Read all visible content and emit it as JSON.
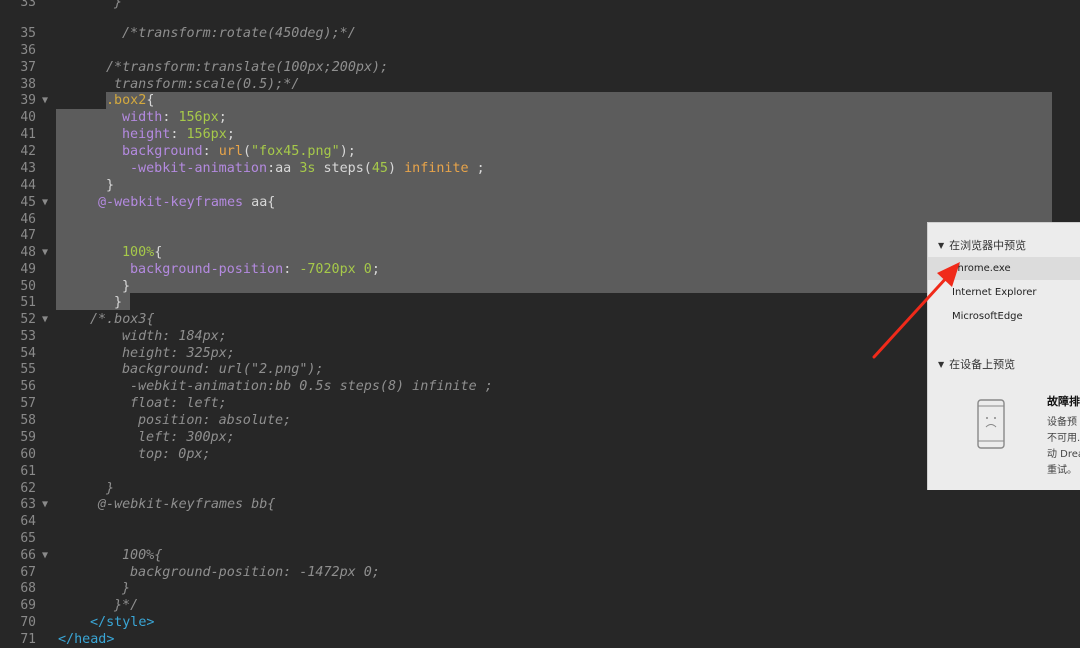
{
  "editor": {
    "lines": [
      {
        "n": "33",
        "fold": "",
        "indent": 114,
        "tokens": [
          [
            "t-com",
            "}"
          ]
        ]
      },
      {
        "n": "35",
        "fold": "",
        "indent": 122,
        "tokens": [
          [
            "t-com",
            "/*transform:rotate(450deg);*/"
          ]
        ]
      },
      {
        "n": "36",
        "fold": "",
        "indent": 122,
        "tokens": []
      },
      {
        "n": "37",
        "fold": "",
        "indent": 106,
        "tokens": [
          [
            "t-com",
            "/*transform:translate(100px;200px);"
          ]
        ]
      },
      {
        "n": "38",
        "fold": "",
        "indent": 114,
        "tokens": [
          [
            "t-com",
            "transform:scale(0.5);*/"
          ]
        ]
      },
      {
        "n": "39",
        "fold": "▼",
        "indent": 106,
        "tokens": [
          [
            "t-sel",
            ".box2"
          ],
          [
            "t-pun",
            "{"
          ]
        ]
      },
      {
        "n": "40",
        "fold": "",
        "indent": 122,
        "tokens": [
          [
            "t-prop",
            "width"
          ],
          [
            "t-pun",
            ": "
          ],
          [
            "t-val",
            "156px"
          ],
          [
            "t-pun",
            ";"
          ]
        ]
      },
      {
        "n": "41",
        "fold": "",
        "indent": 122,
        "tokens": [
          [
            "t-prop",
            "height"
          ],
          [
            "t-pun",
            ": "
          ],
          [
            "t-val",
            "156px"
          ],
          [
            "t-pun",
            ";"
          ]
        ]
      },
      {
        "n": "42",
        "fold": "",
        "indent": 122,
        "tokens": [
          [
            "t-prop",
            "background"
          ],
          [
            "t-pun",
            ": "
          ],
          [
            "t-fn",
            "url"
          ],
          [
            "t-pun",
            "("
          ],
          [
            "t-str",
            "\"fox45.png\""
          ],
          [
            "t-pun",
            ");"
          ]
        ]
      },
      {
        "n": "43",
        "fold": "",
        "indent": 130,
        "tokens": [
          [
            "t-prop",
            "-webkit-animation"
          ],
          [
            "t-pun",
            ":aa "
          ],
          [
            "t-val",
            "3s"
          ],
          [
            "t-pun",
            " steps("
          ],
          [
            "t-val",
            "45"
          ],
          [
            "t-pun",
            ") "
          ],
          [
            "t-fn",
            "infinite"
          ],
          [
            "t-pun",
            " ;"
          ]
        ]
      },
      {
        "n": "44",
        "fold": "",
        "indent": 106,
        "tokens": [
          [
            "t-pun",
            "}"
          ]
        ]
      },
      {
        "n": "45",
        "fold": "▼",
        "indent": 98,
        "tokens": [
          [
            "t-at",
            "@-webkit-keyframes"
          ],
          [
            "t-plain",
            " aa{"
          ]
        ]
      },
      {
        "n": "46",
        "fold": "",
        "indent": 122,
        "tokens": []
      },
      {
        "n": "47",
        "fold": "",
        "indent": 122,
        "tokens": []
      },
      {
        "n": "48",
        "fold": "▼",
        "indent": 122,
        "tokens": [
          [
            "t-val",
            "100%"
          ],
          [
            "t-pun",
            "{"
          ]
        ]
      },
      {
        "n": "49",
        "fold": "",
        "indent": 130,
        "tokens": [
          [
            "t-prop",
            "background-position"
          ],
          [
            "t-pun",
            ": "
          ],
          [
            "t-val",
            "-7020px 0"
          ],
          [
            "t-pun",
            ";"
          ]
        ]
      },
      {
        "n": "50",
        "fold": "",
        "indent": 122,
        "tokens": [
          [
            "t-pun",
            "}"
          ]
        ]
      },
      {
        "n": "51",
        "fold": "",
        "indent": 114,
        "tokens": [
          [
            "t-pun",
            "}"
          ]
        ]
      },
      {
        "n": "52",
        "fold": "▼",
        "indent": 90,
        "tokens": [
          [
            "t-com",
            "/*.box3{"
          ]
        ]
      },
      {
        "n": "53",
        "fold": "",
        "indent": 122,
        "tokens": [
          [
            "t-com",
            "width: 184px;"
          ]
        ]
      },
      {
        "n": "54",
        "fold": "",
        "indent": 122,
        "tokens": [
          [
            "t-com",
            "height: 325px;"
          ]
        ]
      },
      {
        "n": "55",
        "fold": "",
        "indent": 122,
        "tokens": [
          [
            "t-com",
            "background: url(\"2.png\");"
          ]
        ]
      },
      {
        "n": "56",
        "fold": "",
        "indent": 130,
        "tokens": [
          [
            "t-com",
            "-webkit-animation:bb 0.5s steps(8) infinite ;"
          ]
        ]
      },
      {
        "n": "57",
        "fold": "",
        "indent": 130,
        "tokens": [
          [
            "t-com",
            "float: left;"
          ]
        ]
      },
      {
        "n": "58",
        "fold": "",
        "indent": 138,
        "tokens": [
          [
            "t-com",
            "position: absolute;"
          ]
        ]
      },
      {
        "n": "59",
        "fold": "",
        "indent": 138,
        "tokens": [
          [
            "t-com",
            "left: 300px;"
          ]
        ]
      },
      {
        "n": "60",
        "fold": "",
        "indent": 138,
        "tokens": [
          [
            "t-com",
            "top: 0px;"
          ]
        ]
      },
      {
        "n": "61",
        "fold": "",
        "indent": 122,
        "tokens": []
      },
      {
        "n": "62",
        "fold": "",
        "indent": 106,
        "tokens": [
          [
            "t-com",
            "}"
          ]
        ]
      },
      {
        "n": "63",
        "fold": "▼",
        "indent": 98,
        "tokens": [
          [
            "t-com",
            "@-webkit-keyframes bb{"
          ]
        ]
      },
      {
        "n": "64",
        "fold": "",
        "indent": 122,
        "tokens": []
      },
      {
        "n": "65",
        "fold": "",
        "indent": 122,
        "tokens": []
      },
      {
        "n": "66",
        "fold": "▼",
        "indent": 122,
        "tokens": [
          [
            "t-com",
            "100%{"
          ]
        ]
      },
      {
        "n": "67",
        "fold": "",
        "indent": 130,
        "tokens": [
          [
            "t-com",
            "background-position: -1472px 0;"
          ]
        ]
      },
      {
        "n": "68",
        "fold": "",
        "indent": 122,
        "tokens": [
          [
            "t-com",
            "}"
          ]
        ]
      },
      {
        "n": "69",
        "fold": "",
        "indent": 114,
        "tokens": [
          [
            "t-com",
            "}*/"
          ]
        ]
      },
      {
        "n": "70",
        "fold": "",
        "indent": 90,
        "tokens": [
          [
            "t-tag",
            "</style>"
          ]
        ]
      },
      {
        "n": "71",
        "fold": "",
        "indent": 58,
        "tokens": [
          [
            "t-tag",
            "</head>"
          ]
        ]
      }
    ]
  },
  "popup": {
    "browser_section": {
      "icon": "triangle-down-icon",
      "title": "在浏览器中预览"
    },
    "browsers": [
      "chrome.exe",
      "Internet Explorer",
      "MicrosoftEdge"
    ],
    "device_section": {
      "icon": "triangle-down-icon",
      "title": "在设备上预览"
    },
    "trouble_title": "故障排",
    "trouble_lines": [
      "设备预",
      "不可用.",
      "动 Drea",
      "重试。"
    ]
  },
  "annotation": {
    "arrow_color": "#f02a1a"
  },
  "colors": {
    "editor_bg": "#272727",
    "selection": "#5c5c5c",
    "popup_bg": "#ececec"
  }
}
